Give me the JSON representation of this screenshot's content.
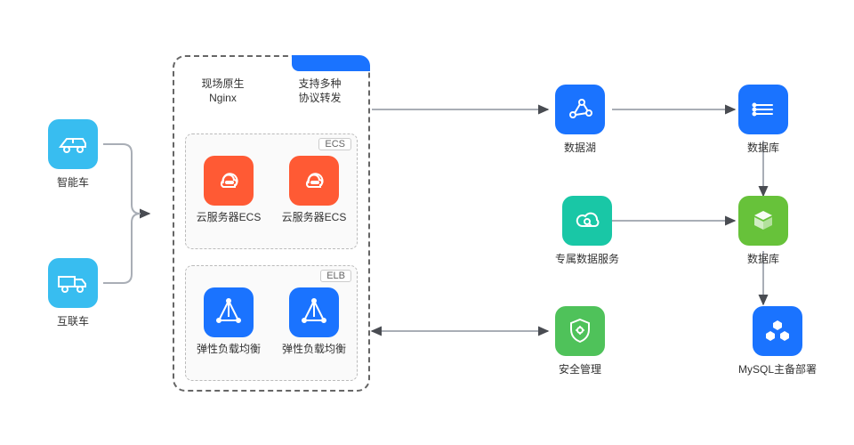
{
  "left": {
    "car": {
      "label": "智能车"
    },
    "truck": {
      "label": "互联车"
    }
  },
  "cluster": {
    "header": {
      "left_line1": "现场原生",
      "left_line2": "Nginx",
      "right_line1": "支持多种",
      "right_line2": "协议转发"
    },
    "ecs": {
      "tag": "ECS",
      "a": "云服务器ECS",
      "b": "云服务器ECS"
    },
    "elb": {
      "tag": "ELB",
      "a": "弹性负载均衡",
      "b": "弹性负载均衡"
    }
  },
  "right": {
    "dataLake": {
      "label": "数据湖"
    },
    "dataWare": {
      "label": "数据库"
    },
    "cloudSvc": {
      "label": "专属数据服务"
    },
    "appWare": {
      "label": "数据库"
    },
    "security": {
      "label": "安全管理"
    },
    "mysql": {
      "label": "MySQL主备部署"
    }
  },
  "colors": {
    "sky": "#38bdf0",
    "orange": "#ff5a34",
    "blue": "#1a73ff",
    "teal": "#19c7a6",
    "green1": "#4fc25a",
    "green2": "#67c23a"
  }
}
